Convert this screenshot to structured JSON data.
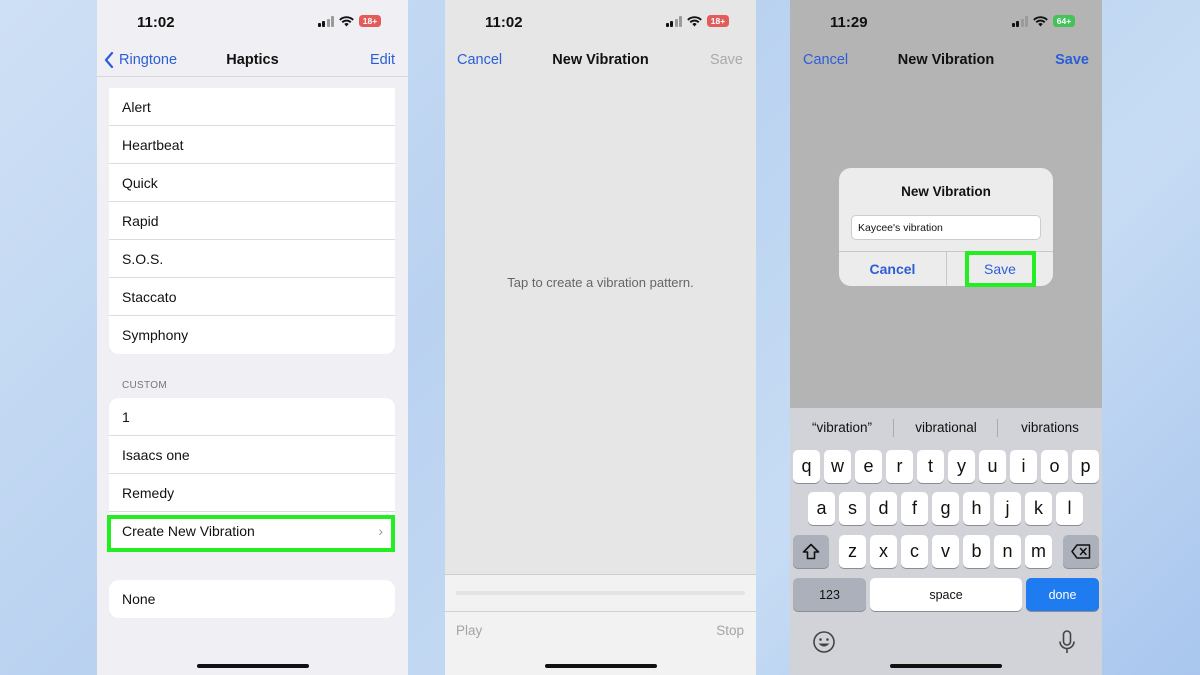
{
  "panel1": {
    "status": {
      "time": "11:02",
      "battery": "18+"
    },
    "nav": {
      "back": "Ringtone",
      "title": "Haptics",
      "edit": "Edit"
    },
    "standard_items": [
      "Alert",
      "Heartbeat",
      "Quick",
      "Rapid",
      "S.O.S.",
      "Staccato",
      "Symphony"
    ],
    "custom_header": "CUSTOM",
    "custom_items": [
      "1",
      "Isaacs one",
      "Remedy"
    ],
    "create_new": "Create New Vibration",
    "none": "None"
  },
  "panel2": {
    "status": {
      "time": "11:02",
      "battery": "18+"
    },
    "nav": {
      "cancel": "Cancel",
      "title": "New Vibration",
      "save": "Save"
    },
    "hint": "Tap to create a vibration pattern.",
    "play": "Play",
    "stop": "Stop"
  },
  "panel3": {
    "status": {
      "time": "11:29",
      "battery": "64+"
    },
    "nav": {
      "cancel": "Cancel",
      "title": "New Vibration",
      "save": "Save"
    },
    "dialog": {
      "title": "New Vibration",
      "input_value": "Kaycee's vibration",
      "cancel": "Cancel",
      "save": "Save"
    },
    "suggestions": [
      "“vibration”",
      "vibrational",
      "vibrations"
    ],
    "keyboard": {
      "row1": [
        "q",
        "w",
        "e",
        "r",
        "t",
        "y",
        "u",
        "i",
        "o",
        "p"
      ],
      "row2": [
        "a",
        "s",
        "d",
        "f",
        "g",
        "h",
        "j",
        "k",
        "l"
      ],
      "row3": [
        "z",
        "x",
        "c",
        "v",
        "b",
        "n",
        "m"
      ],
      "numbers": "123",
      "space": "space",
      "done": "done"
    }
  },
  "colors": {
    "accent_blue": "#2b5ed6",
    "highlight_green": "#22ee22",
    "battery_red": "#e35c5c",
    "battery_green": "#43c35a"
  }
}
